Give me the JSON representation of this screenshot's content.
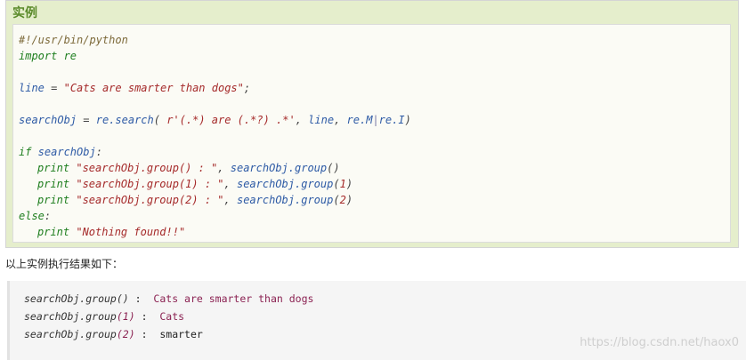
{
  "example": {
    "title": "实例",
    "code": {
      "shebang": "#!/usr/bin/python",
      "import_kw": "import",
      "import_mod": " re",
      "line_var": "line",
      "line_eq": " = ",
      "line_str": "\"Cats are smarter than dogs\"",
      "line_semi": ";",
      "search_var": "searchObj",
      "search_eq": " = ",
      "search_call": "re.search",
      "search_open": "( ",
      "search_pattern": "r'(.*) are (.*?) .*'",
      "search_comma": ", ",
      "search_arg": "line",
      "search_comma2": ", ",
      "search_flag1": "re.M",
      "search_pipe": "|",
      "search_flag2": "re.I",
      "search_close": ")",
      "if_kw": "if",
      "if_cond": " searchObj",
      "if_colon": ":",
      "print_kw": "print",
      "p1_str": " \"searchObj.group() : \"",
      "p1_sep": ", ",
      "p1_call": "searchObj.group",
      "p1_args": "()",
      "p2_str": " \"searchObj.group(1) : \"",
      "p2_sep": ", ",
      "p2_call": "searchObj.group",
      "p2_open": "(",
      "p2_num": "1",
      "p2_close": ")",
      "p3_str": " \"searchObj.group(2) : \"",
      "p3_sep": ", ",
      "p3_call": "searchObj.group",
      "p3_open": "(",
      "p3_num": "2",
      "p3_close": ")",
      "else_kw": "else",
      "else_colon": ":",
      "p4_str": " \"Nothing found!!\""
    }
  },
  "result": {
    "caption": "以上实例执行结果如下：",
    "lines": [
      {
        "call": "searchObj.group",
        "arg": "()",
        "sep": " :  ",
        "value": "Cats are smarter than dogs"
      },
      {
        "call": "searchObj.group",
        "arg": "(1)",
        "sep": " :  ",
        "value": "Cats"
      },
      {
        "call": "searchObj.group",
        "arg": "(2)",
        "sep": " :  ",
        "value": "smarter"
      }
    ]
  },
  "watermark": "https://blog.csdn.net/haox0"
}
